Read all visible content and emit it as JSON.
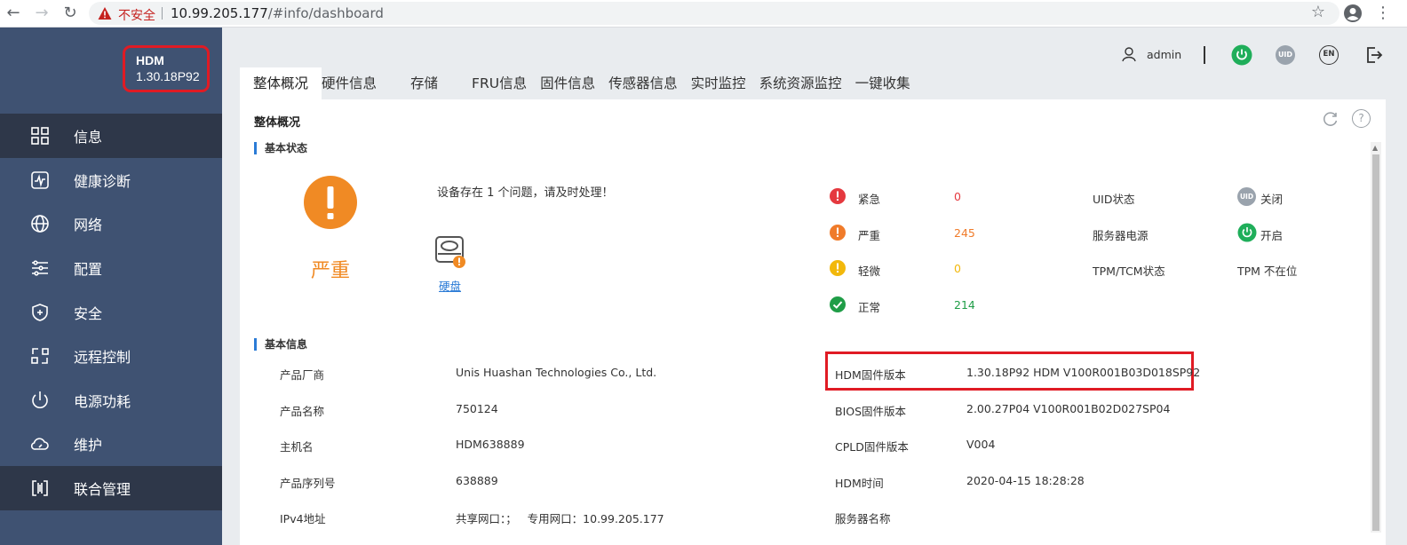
{
  "browser": {
    "insecure_label": "不安全",
    "url_host": "10.99.205.177",
    "url_path": "/#info/dashboard"
  },
  "brand": {
    "name": "HDM",
    "version": "1.30.18P92"
  },
  "sidebar": {
    "items": [
      {
        "label": "信息",
        "icon": "grid-icon"
      },
      {
        "label": "健康诊断",
        "icon": "health-monitor-icon"
      },
      {
        "label": "网络",
        "icon": "globe-icon"
      },
      {
        "label": "配置",
        "icon": "sliders-icon"
      },
      {
        "label": "安全",
        "icon": "shield-plus-icon"
      },
      {
        "label": "远程控制",
        "icon": "remote-control-icon"
      },
      {
        "label": "电源功耗",
        "icon": "power-icon"
      },
      {
        "label": "维护",
        "icon": "cloud-wrench-icon"
      },
      {
        "label": "联合管理",
        "icon": "federation-icon"
      }
    ]
  },
  "header": {
    "user": "admin",
    "uid_label": "UID",
    "en_label": "EN"
  },
  "tabs": [
    "整体概况",
    "硬件信息",
    "存储",
    "FRU信息",
    "固件信息",
    "传感器信息",
    "实时监控",
    "系统资源监控",
    "一键收集"
  ],
  "panel": {
    "title": "整体概况",
    "basic_status_title": "基本状态",
    "status_word": "严重",
    "problem_message": "设备存在 1 个问题，请及时处理！",
    "problem_item": "硬盘",
    "counts": [
      {
        "label": "紧急",
        "value": "0",
        "color": "#e5393f"
      },
      {
        "label": "严重",
        "value": "245",
        "color": "#f07b2a"
      },
      {
        "label": "轻微",
        "value": "0",
        "color": "#f2b80c"
      },
      {
        "label": "正常",
        "value": "214",
        "color": "#1f9d47"
      }
    ],
    "right_status": [
      {
        "label": "UID状态",
        "value": "关闭",
        "badge": "UID"
      },
      {
        "label": "服务器电源",
        "value": "开启"
      },
      {
        "label": "TPM/TCM状态",
        "value": "TPM 不在位"
      }
    ],
    "basic_info_title": "基本信息",
    "info_left": [
      {
        "label": "产品厂商",
        "value": "Unis Huashan Technologies Co., Ltd."
      },
      {
        "label": "产品名称",
        "value": "750124"
      },
      {
        "label": "主机名",
        "value": "HDM638889"
      },
      {
        "label": "产品序列号",
        "value": "638889"
      },
      {
        "label": "IPv4地址",
        "value": "共享网口：；   专用网口：10.99.205.177"
      }
    ],
    "info_right": [
      {
        "label": "HDM固件版本",
        "value": "1.30.18P92 HDM V100R001B03D018SP92"
      },
      {
        "label": "BIOS固件版本",
        "value": "2.00.27P04 V100R001B02D027SP04"
      },
      {
        "label": "CPLD固件版本",
        "value": "V004"
      },
      {
        "label": "HDM时间",
        "value": "2020-04-15 18:28:28"
      },
      {
        "label": "服务器名称",
        "value": ""
      }
    ]
  },
  "colors": {
    "sidebar_bg": "#3f5272",
    "sidebar_active": "#2e3749",
    "accent_blue": "#2b7bd6",
    "highlight_red": "#e01b24",
    "severe_orange": "#f08a24",
    "power_green": "#1fae5a"
  }
}
